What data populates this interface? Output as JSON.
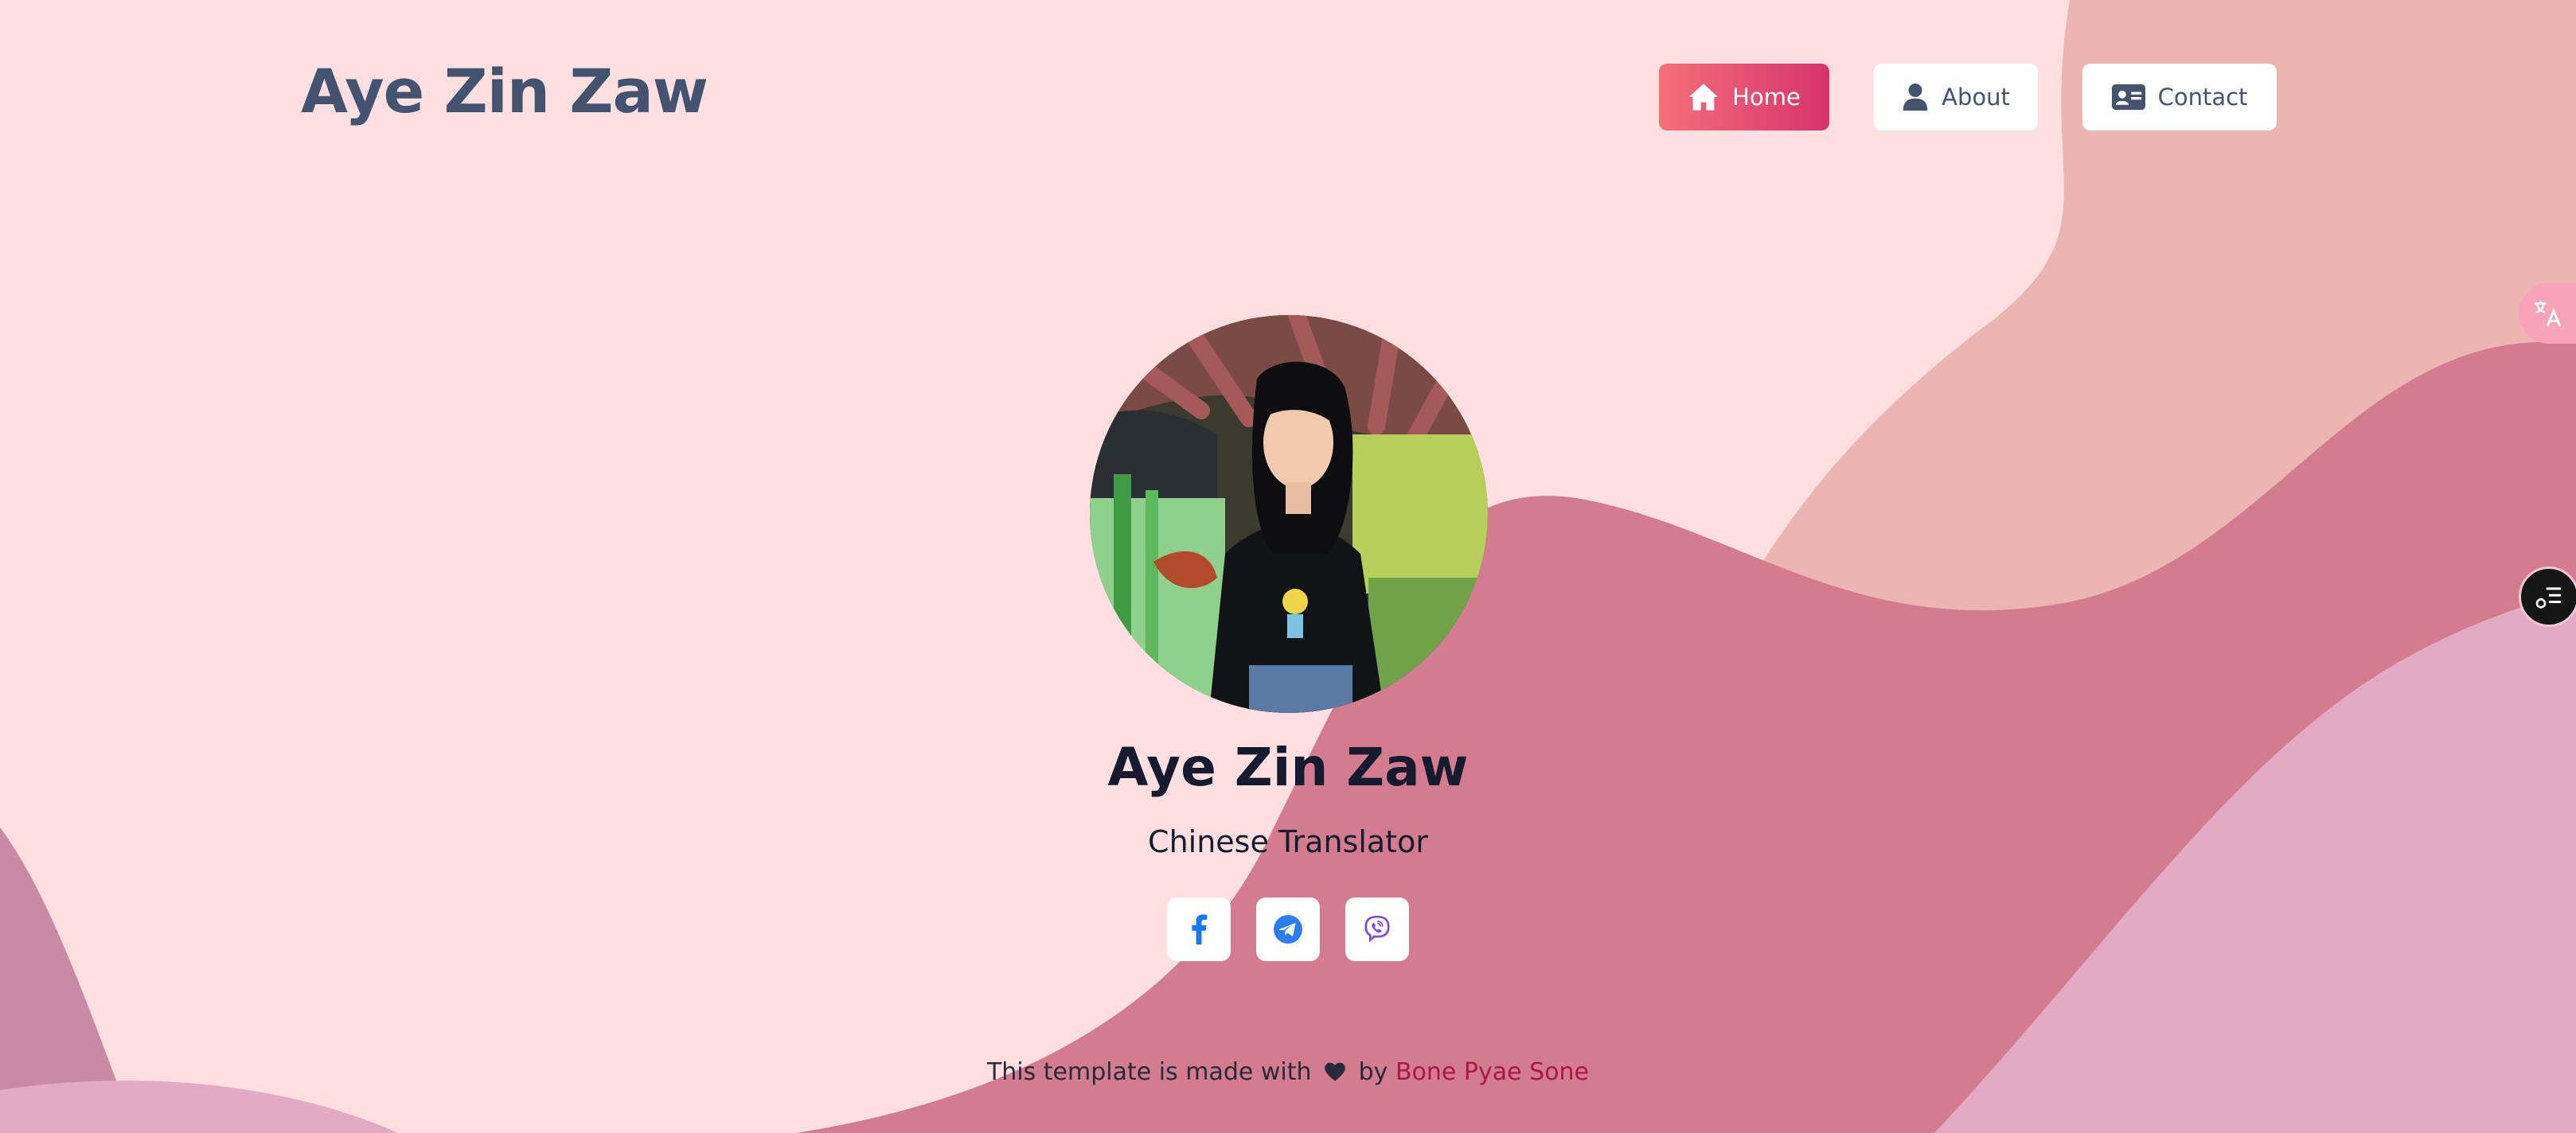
{
  "header": {
    "site_title": "Aye Zin Zaw"
  },
  "nav": {
    "items": [
      {
        "label": "Home",
        "icon": "home-icon",
        "active": true
      },
      {
        "label": "About",
        "icon": "user-icon",
        "active": false
      },
      {
        "label": "Contact",
        "icon": "contact-card-icon",
        "active": false
      }
    ]
  },
  "profile": {
    "name": "Aye Zin Zaw",
    "role": "Chinese Translator",
    "socials": [
      {
        "icon": "facebook-icon",
        "color": "#1877f2"
      },
      {
        "icon": "telegram-icon",
        "color": "#2a7ef0"
      },
      {
        "icon": "viber-icon",
        "color": "#7d4cdb"
      }
    ]
  },
  "footer": {
    "text_before": "This template is made with",
    "text_by": "by",
    "author": "Bone Pyae Sone"
  },
  "colors": {
    "background": "#ffdfe0",
    "accent_start": "#f4707a",
    "accent_end": "#d6336c",
    "wave_light": "#ebb5b1",
    "wave_main": "#d37b8f",
    "wave_pink": "#e3aac6",
    "title": "#445470"
  },
  "side_controls": [
    "translate-icon",
    "menu-icon"
  ]
}
